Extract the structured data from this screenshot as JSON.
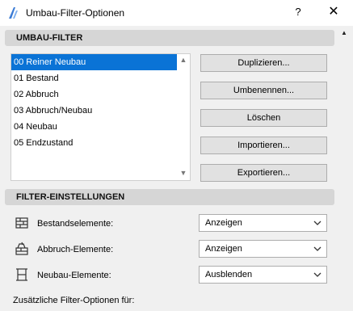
{
  "window": {
    "title": "Umbau-Filter-Optionen",
    "help": "?",
    "close": "✕"
  },
  "filter_section": {
    "header": "UMBAU-FILTER",
    "items": [
      {
        "label": "00 Reiner Neubau",
        "selected": true
      },
      {
        "label": "01 Bestand",
        "selected": false
      },
      {
        "label": "02 Abbruch",
        "selected": false
      },
      {
        "label": "03 Abbruch/Neubau",
        "selected": false
      },
      {
        "label": "04 Neubau",
        "selected": false
      },
      {
        "label": "05 Endzustand",
        "selected": false
      }
    ],
    "buttons": {
      "duplicate": "Duplizieren...",
      "rename": "Umbenennen...",
      "delete": "Löschen",
      "import": "Importieren...",
      "export": "Exportieren..."
    }
  },
  "settings_section": {
    "header": "FILTER-EINSTELLUNGEN",
    "rows": [
      {
        "icon": "existing-elements-icon",
        "label": "Bestandselemente:",
        "value": "Anzeigen"
      },
      {
        "icon": "demolition-elements-icon",
        "label": "Abbruch-Elemente:",
        "value": "Anzeigen"
      },
      {
        "icon": "new-elements-icon",
        "label": "Neubau-Elemente:",
        "value": "Ausblenden"
      }
    ],
    "extra_label": "Zusätzliche Filter-Optionen für:"
  },
  "colors": {
    "selection": "#0a73d6",
    "section_header": "#d6d6d6",
    "dialog_bg": "#f0f0f0"
  }
}
